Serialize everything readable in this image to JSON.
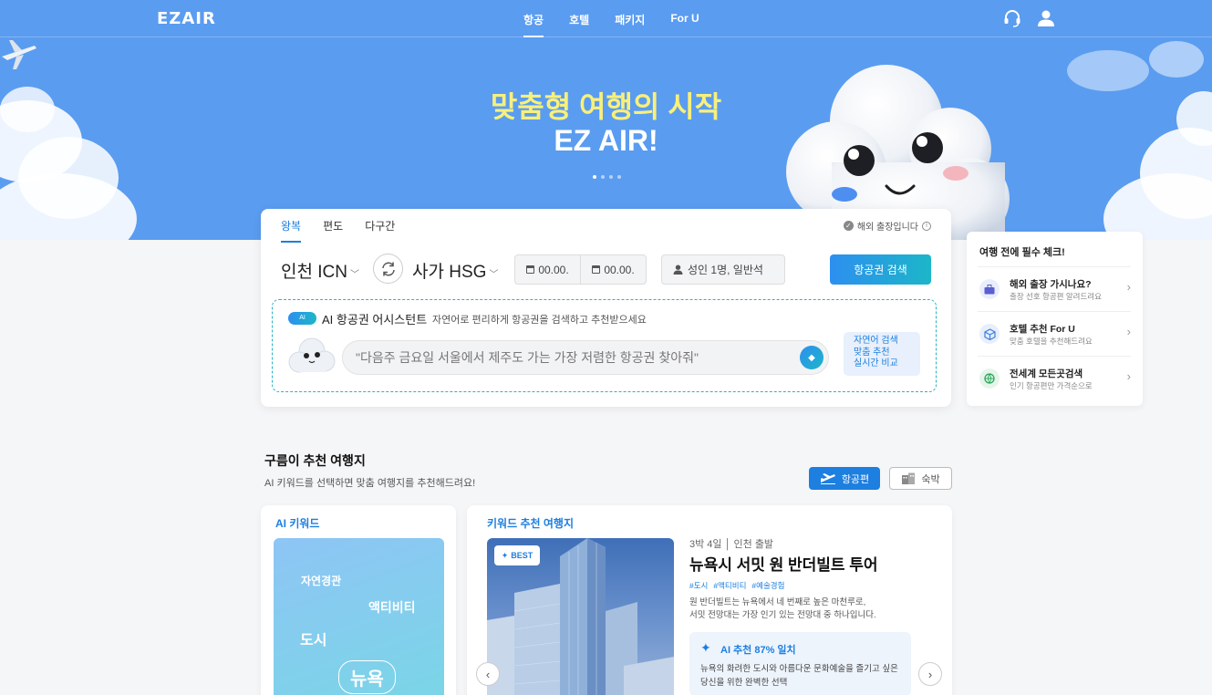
{
  "header": {
    "logo": "EZAIR",
    "nav": [
      "항공",
      "호텔",
      "패키지",
      "For U"
    ],
    "active_nav": "항공"
  },
  "hero": {
    "title_line1": "맞춤형 여행의 시작",
    "title_line2": "EZ AIR!",
    "slide_count": 4,
    "active_slide": 1
  },
  "search": {
    "tabs": [
      "왕복",
      "편도",
      "다구간"
    ],
    "active_tab": "왕복",
    "business_trip_label": "해외 출장입니다",
    "origin": "인천 ICN",
    "destination": "사가 HSG",
    "depart_date": "00.00.",
    "return_date": "00.00.",
    "passengers": "성인 1명, 일반석",
    "search_button": "항공권 검색",
    "ai": {
      "badge": "AI",
      "title": "AI 항공권 어시스턴트",
      "description": "자연어로 편리하게 항공권을 검색하고 추천받으세요",
      "placeholder": "\"다음주 금요일 서울에서 제주도 가는 가장 저렴한 항공권 찾아줘\"",
      "features": [
        "자연어 검색",
        "맞춤 추천",
        "실시간 비교"
      ]
    }
  },
  "checklist": {
    "title": "여행 전에 필수 체크!",
    "items": [
      {
        "title": "해외 출장 가시나요?",
        "subtitle": "출장 선호 항공편 알려드려요",
        "icon": "briefcase-icon"
      },
      {
        "title": "호텔 추천 For U",
        "subtitle": "맞춤 호텔을 추천해드려요",
        "icon": "hotel-cube-icon"
      },
      {
        "title": "전세계 모든곳검색",
        "subtitle": "인기 항공편만 가격순으로",
        "icon": "globe-search-icon"
      }
    ]
  },
  "recommend": {
    "title": "구름이 추천 여행지",
    "subtitle": "AI 키워드를 선택하면 맞춤 여행지를 추천해드려요!",
    "toggle_flight": "항공편",
    "toggle_stay": "숙박",
    "keyword_label": "AI 키워드",
    "keywords": [
      "자연경관",
      "액티비티",
      "도시",
      "뉴욕"
    ],
    "selected_keyword": "뉴욕",
    "dest_label": "키워드 추천 여행지",
    "best_badge": "BEST",
    "trip_meta": "3박 4일 │ 인천 출발",
    "trip_name": "뉴욕시 서밋 원 반더빌트 투어",
    "tags": [
      "#도시",
      "#액티비티",
      "#예술경험"
    ],
    "desc_lines": [
      "원 반더빌트는 뉴욕에서 네 번째로 높은 마천루로,",
      "서밋 전망대는 가장 인기 있는 전망대 중 하나입니다."
    ],
    "ai_match_title": "AI 추천 87% 일치",
    "ai_match_lines": [
      "뉴욕의 화려한 도시와 아름다운 문화예술을 즐기고 싶은",
      "당신을 위한 완벽한 선택"
    ]
  },
  "colors": {
    "hero_bg": "#5a9cf0",
    "accent": "#1d7fe0",
    "title_yellow": "#f8f07a",
    "teal": "#1cb6c8"
  }
}
